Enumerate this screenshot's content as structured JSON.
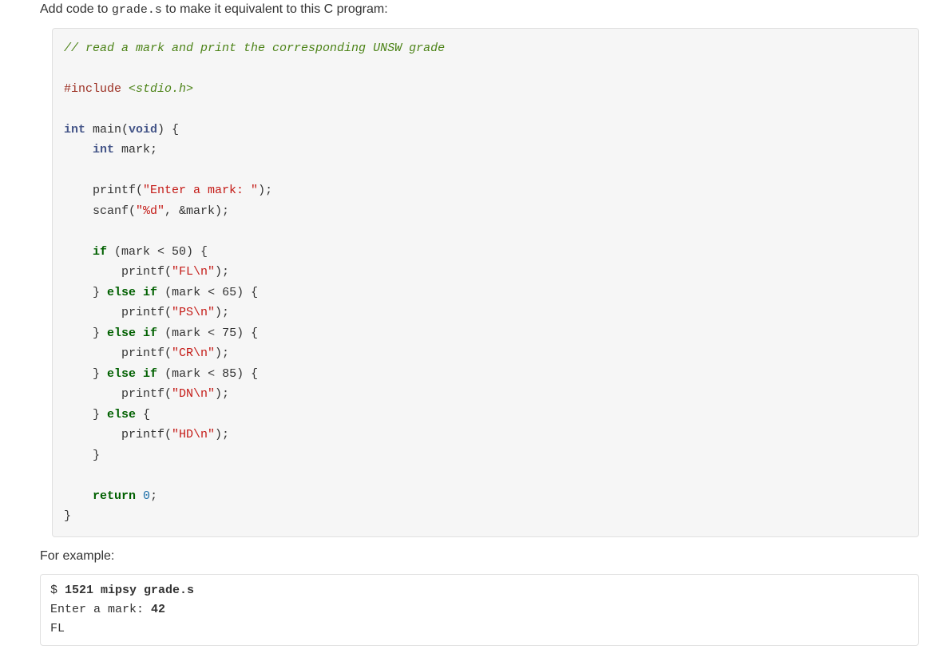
{
  "intro": {
    "prefix": "Add code to ",
    "filename": "grade.s",
    "suffix": " to make it equivalent to this C program:"
  },
  "code": {
    "comment": "// read a mark and print the corresponding UNSW grade",
    "include_kw": "#include",
    "include_hdr": "<stdio.h>",
    "type_int": "int",
    "main_sig_after_int": " main(",
    "void_kw": "void",
    "main_sig_close": ") {",
    "decl_after_int": " mark;",
    "printf_name": "    printf(",
    "scanf_name": "    scanf(",
    "prompt_str": "\"Enter a mark: \"",
    "scan_fmt": "\"%d\"",
    "scan_arg": ", &mark);",
    "if_kw": "if",
    "if_cond": " (mark < 50) {",
    "fl_str": "\"FL\\n\"",
    "else_kw": "else",
    "elif1_cond": " (mark < 65) {",
    "ps_str": "\"PS\\n\"",
    "elif2_cond": " (mark < 75) {",
    "cr_str": "\"CR\\n\"",
    "elif3_cond": " (mark < 85) {",
    "dn_str": "\"DN\\n\"",
    "else_open": " {",
    "hd_str": "\"HD\\n\"",
    "return_kw": "return",
    "return_val": "0",
    "semi": ";",
    "close_paren_semi": ");",
    "printf_inner_open": "        printf(",
    "brace_close_inner": "    }",
    "brace_close_else_if": "    } ",
    "brace_close_main": "}"
  },
  "example_label": "For example:",
  "terminal": {
    "prompt_sym": "$",
    "cmd_bold": " 1521 mipsy grade.s",
    "line2_prefix": "Enter a mark: ",
    "line2_input": "42",
    "line3": "FL"
  }
}
